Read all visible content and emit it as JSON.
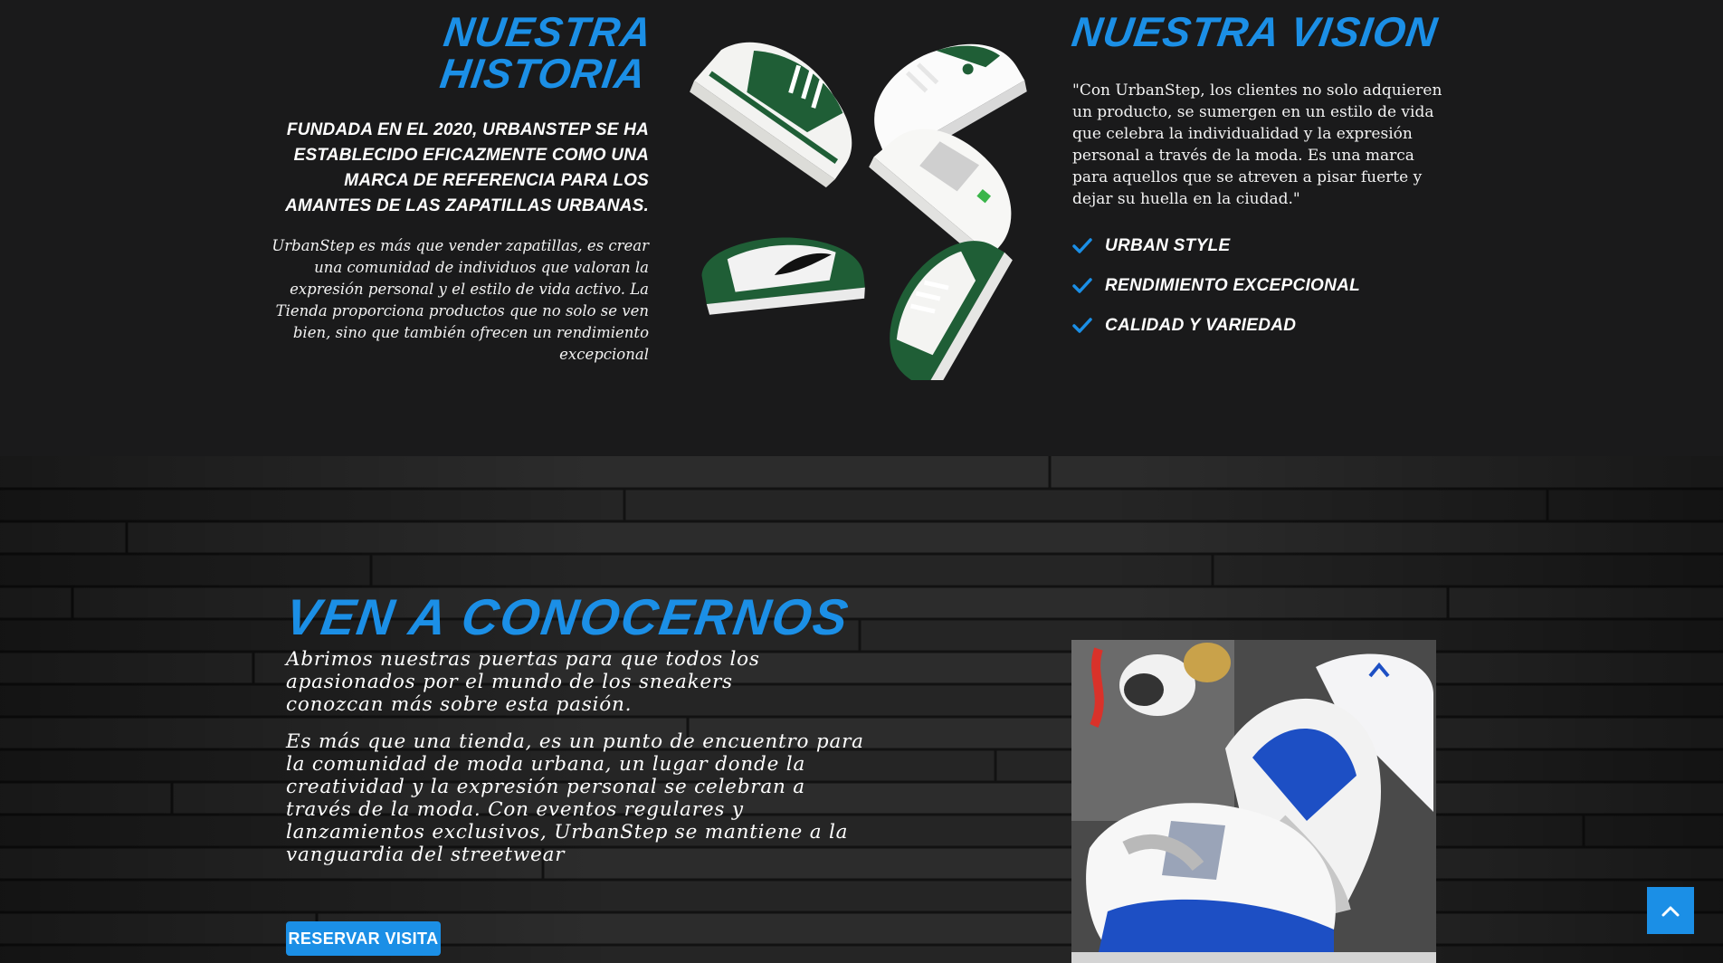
{
  "historia": {
    "title": "Nuestra Historia",
    "lead": "Fundada en el 2020, UrbanStep se ha establecido eficazmente como una marca de referencia para los amantes de las zapatillas urbanas.",
    "body": "UrbanStep es más que vender zapatillas, es crear una comunidad de individuos que valoran la expresión personal y el estilo de vida activo. La Tienda proporciona productos que no solo se ven bien, sino que también ofrecen un rendimiento excepcional"
  },
  "vision": {
    "title": "Nuestra Vision",
    "body": "\"Con UrbanStep, los clientes no solo adquieren un producto, se sumergen en un estilo de vida que celebra la individualidad y la expresión personal a través de la moda. Es una marca para aquellos que se atreven a pisar fuerte y dejar su huella en la ciudad.\"",
    "items": [
      {
        "label": "Urban Style",
        "icon": "check-icon"
      },
      {
        "label": "Rendimiento Excepcional",
        "icon": "check-icon"
      },
      {
        "label": "Calidad y Variedad",
        "icon": "check-icon"
      }
    ]
  },
  "conocer": {
    "title": "Ven a conocernos",
    "p1": "Abrimos nuestras puertas para que todos los apasionados por el mundo de los sneakers conozcan más sobre esta pasión.",
    "p2": "Es más que una tienda, es un punto de encuentro para la comunidad de moda urbana, un lugar donde la creatividad y la expresión personal se celebran a través de la moda. Con eventos regulares y lanzamientos exclusivos, UrbanStep se mantiene a la vanguardia del streetwear",
    "button_label": "Reservar visita"
  },
  "scroll_top": {
    "icon": "chevron-up-icon"
  },
  "colors": {
    "accent": "#1b8fe6",
    "background": "#1a1a1b",
    "shoe_green": "#1f5e36",
    "shoe_blue": "#1d4fc4"
  }
}
